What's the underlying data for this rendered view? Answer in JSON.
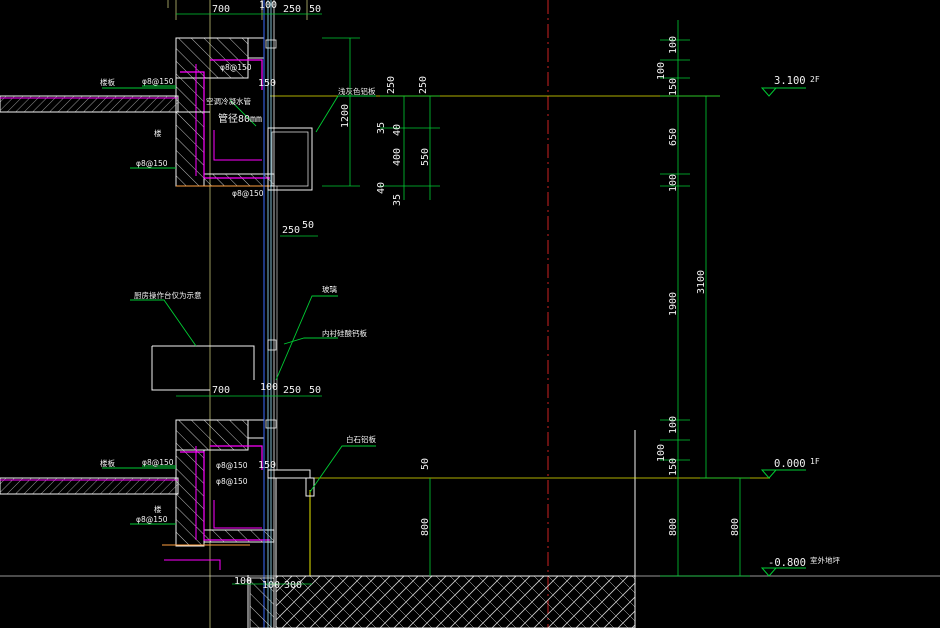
{
  "colors": {
    "background": "#000000",
    "wall_white": "#f2f2f2",
    "magenta": "#ff00ff",
    "green": "#00cc33",
    "yellow": "#e8e800",
    "light_yellow": "#ffff99",
    "blue": "#3a6bff",
    "red": "#cc2222",
    "cyan": "#9fe8ff",
    "orange": "#ffa040"
  },
  "dims": {
    "d700_top": "700",
    "d100_top": "100",
    "d250_top": "250",
    "d50_top": "50",
    "d150_a": "150",
    "d250_b": "250",
    "d50_b": "50",
    "d700_mid": "700",
    "d100_mid": "100",
    "d250_mid": "250",
    "d50_mid": "50",
    "d150_mid": "150",
    "d100_bot": "100",
    "d100_bot2": "100",
    "d300_bot": "300",
    "d1200": "1200",
    "d250_v1": "250",
    "d250_v2": "250",
    "d35_a": "35",
    "d40_a": "40",
    "d400": "400",
    "d550": "550",
    "d40_b": "40",
    "d35_b": "35",
    "d50_v": "50",
    "d800_a": "800",
    "r_100a": "100",
    "r_100b": "100",
    "r_150a": "150",
    "r_650": "650",
    "r_100c": "100",
    "r_1900": "1900",
    "r_3100": "3100",
    "r_100d": "100",
    "r_100e": "100",
    "r_150b": "150",
    "r_800": "800",
    "r_800b": "800"
  },
  "levels": {
    "l1_value": "3.100",
    "l1_tag": "2F",
    "l2_value": "0.000",
    "l2_tag": "1F",
    "l3_value": "-0.800",
    "l3_tag": "室外地坪"
  },
  "labels": {
    "floor_top": "楼板",
    "phi_top": "φ8@150",
    "phi_top2": "φ8@150",
    "ann_pipe": "空调冷凝水管",
    "ann_pipe2": "管径80mm",
    "phi_top_lower": "φ8@150",
    "dim_label_150": "150",
    "stair_top": "楼",
    "phi_mid_left": "φ8@150",
    "callout_1": "浅灰色铝板",
    "callout_2": "厨房操作台仅为示意",
    "callout_3": "玻璃",
    "callout_4": "内衬硅酸钙板",
    "callout_5": "白石铝板",
    "floor_bot": "楼板",
    "phi_bot": "φ8@150",
    "phi_bot2": "φ8@150",
    "phi_bot3": "φ8@150",
    "stair_bot": "楼",
    "phi_bot4": "φ8@150"
  }
}
